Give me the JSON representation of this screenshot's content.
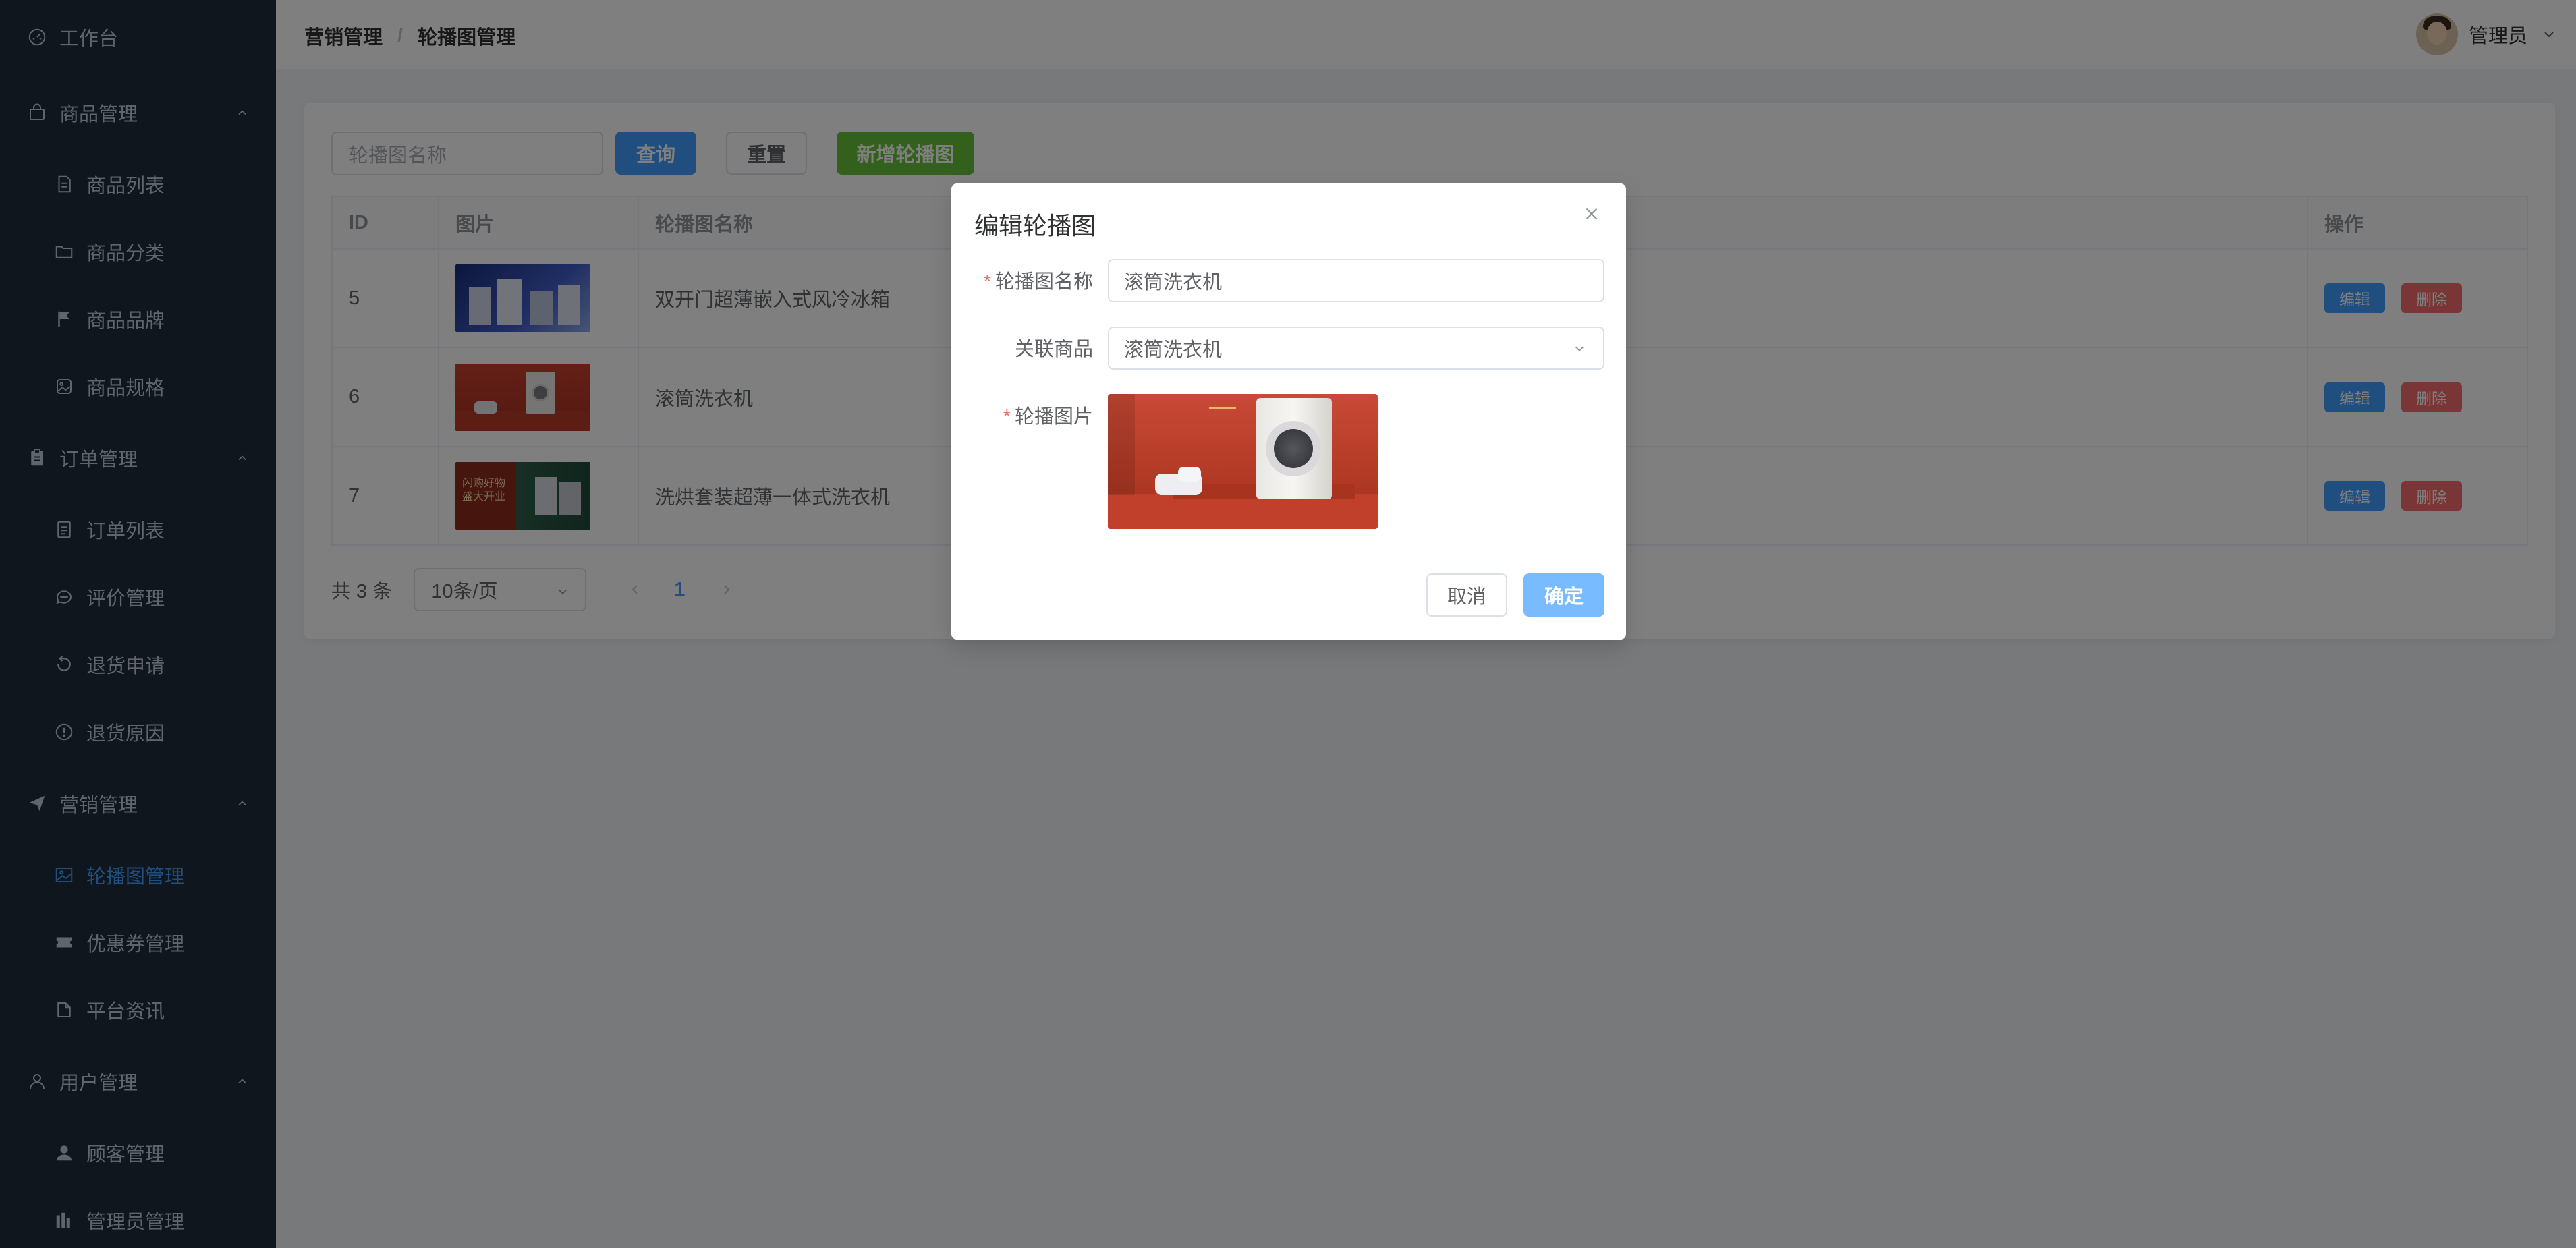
{
  "colors": {
    "sidebar_bg": "#1f2d3d",
    "sidebar_text": "#bfcbd9",
    "accent": "#409eff",
    "success": "#67c23a",
    "danger": "#f56c6c"
  },
  "sidebar": {
    "items": [
      {
        "label": "工作台",
        "icon": "dashboard-icon",
        "type": "top"
      },
      {
        "label": "商品管理",
        "icon": "shopping-bag-icon",
        "type": "group"
      },
      {
        "label": "商品列表",
        "icon": "document-icon",
        "type": "sub"
      },
      {
        "label": "商品分类",
        "icon": "folder-icon",
        "type": "sub"
      },
      {
        "label": "商品品牌",
        "icon": "flag-icon",
        "type": "sub"
      },
      {
        "label": "商品规格",
        "icon": "picture-rounded-icon",
        "type": "sub"
      },
      {
        "label": "订单管理",
        "icon": "clipboard-icon",
        "type": "group"
      },
      {
        "label": "订单列表",
        "icon": "tickets-icon",
        "type": "sub"
      },
      {
        "label": "评价管理",
        "icon": "chat-icon",
        "type": "sub"
      },
      {
        "label": "退货申请",
        "icon": "refresh-icon",
        "type": "sub"
      },
      {
        "label": "退货原因",
        "icon": "warning-icon",
        "type": "sub"
      },
      {
        "label": "营销管理",
        "icon": "promotion-icon",
        "type": "group"
      },
      {
        "label": "轮播图管理",
        "icon": "picture-icon",
        "type": "sub",
        "active": true
      },
      {
        "label": "优惠券管理",
        "icon": "ticket-icon",
        "type": "sub"
      },
      {
        "label": "平台资讯",
        "icon": "news-icon",
        "type": "sub"
      },
      {
        "label": "用户管理",
        "icon": "user-icon",
        "type": "group"
      },
      {
        "label": "顾客管理",
        "icon": "user-filled-icon",
        "type": "sub"
      },
      {
        "label": "管理员管理",
        "icon": "histogram-icon",
        "type": "sub"
      }
    ]
  },
  "header": {
    "breadcrumb": [
      "营销管理",
      "轮播图管理"
    ],
    "separator": "/",
    "user_name": "管理员"
  },
  "toolbar": {
    "search_placeholder": "轮播图名称",
    "query_label": "查询",
    "reset_label": "重置",
    "add_label": "新增轮播图"
  },
  "table": {
    "columns": [
      "ID",
      "图片",
      "轮播图名称",
      "操作"
    ],
    "rows": [
      {
        "id": "5",
        "name": "双开门超薄嵌入式风冷冰箱",
        "image": "appliances-banner"
      },
      {
        "id": "6",
        "name": "滚筒洗衣机",
        "image": "washer-banner"
      },
      {
        "id": "7",
        "name": "洗烘套装超薄一体式洗衣机",
        "image": "washer-dryer-banner"
      }
    ],
    "edit_label": "编辑",
    "delete_label": "删除"
  },
  "pagination": {
    "total_text": "共 3 条",
    "page_size": "10条/页",
    "current_page": "1"
  },
  "dialog": {
    "title": "编辑轮播图",
    "name_label": "轮播图名称",
    "name_value": "滚筒洗衣机",
    "product_label": "关联商品",
    "product_value": "滚筒洗衣机",
    "image_label": "轮播图片",
    "required_mark": "*",
    "cancel_label": "取消",
    "confirm_label": "确定"
  },
  "thumb_texts": {
    "row7_line1": "闪购好物",
    "row7_line2": "盛大开业"
  }
}
